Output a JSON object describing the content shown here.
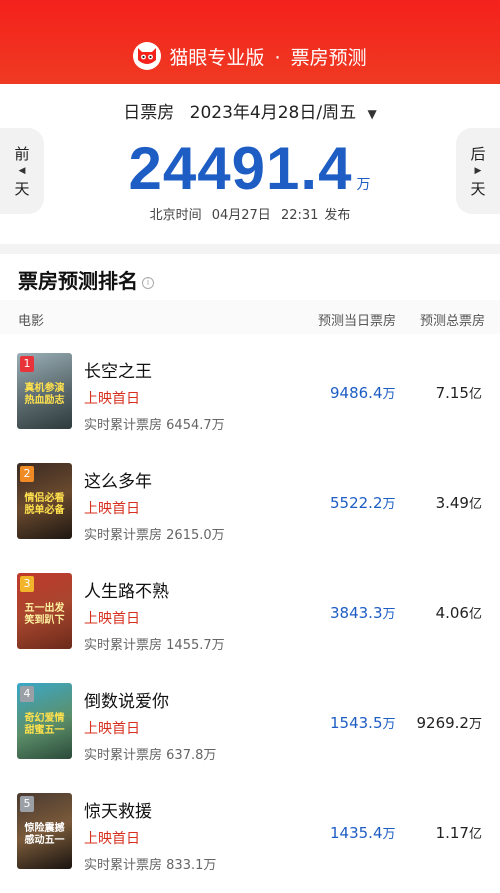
{
  "header": {
    "app_name": "猫眼专业版",
    "separator": "·",
    "page_name": "票房预测"
  },
  "summary": {
    "date_label": "日票房",
    "date_value": "2023年4月28日/周五",
    "dropdown_icon": "caret-down-icon",
    "total_box_office": "24491.4",
    "unit": "万",
    "publish_prefix": "北京时间",
    "publish_date": "04月27日",
    "publish_time": "22:31",
    "publish_suffix": "发布"
  },
  "nav": {
    "prev_label_1": "前",
    "prev_label_2": "天",
    "next_label_1": "后",
    "next_label_2": "天"
  },
  "ranking": {
    "title": "票房预测排名",
    "info_icon": "info-icon",
    "columns": {
      "movie": "电影",
      "predicted_today": "预测当日票房",
      "predicted_total": "预测总票房"
    },
    "movies": [
      {
        "rank": "1",
        "title": "长空之王",
        "tag": "上映首日",
        "realtime_label": "实时累计票房",
        "realtime_value": "6454.7万",
        "pred_value": "9486.4",
        "pred_unit": "万",
        "total_value": "7.15",
        "total_unit": "亿",
        "poster_slogan": "真机参演 热血励志"
      },
      {
        "rank": "2",
        "title": "这么多年",
        "tag": "上映首日",
        "realtime_label": "实时累计票房",
        "realtime_value": "2615.0万",
        "pred_value": "5522.2",
        "pred_unit": "万",
        "total_value": "3.49",
        "total_unit": "亿",
        "poster_slogan": "情侣必看 脱单必备"
      },
      {
        "rank": "3",
        "title": "人生路不熟",
        "tag": "上映首日",
        "realtime_label": "实时累计票房",
        "realtime_value": "1455.7万",
        "pred_value": "3843.3",
        "pred_unit": "万",
        "total_value": "4.06",
        "total_unit": "亿",
        "poster_slogan": "五一出发 笑到趴下"
      },
      {
        "rank": "4",
        "title": "倒数说爱你",
        "tag": "上映首日",
        "realtime_label": "实时累计票房",
        "realtime_value": "637.8万",
        "pred_value": "1543.5",
        "pred_unit": "万",
        "total_value": "9269.2",
        "total_unit": "万",
        "poster_slogan": "奇幻爱情 甜蜜五一"
      },
      {
        "rank": "5",
        "title": "惊天救援",
        "tag": "上映首日",
        "realtime_label": "实时累计票房",
        "realtime_value": "833.1万",
        "pred_value": "1435.4",
        "pred_unit": "万",
        "total_value": "1.17",
        "total_unit": "亿",
        "poster_slogan": "惊险震撼 感动五一"
      }
    ]
  },
  "colors": {
    "brand_red": "#f4211c",
    "number_blue": "#1e5dc4",
    "tag_red": "#d7301f"
  }
}
